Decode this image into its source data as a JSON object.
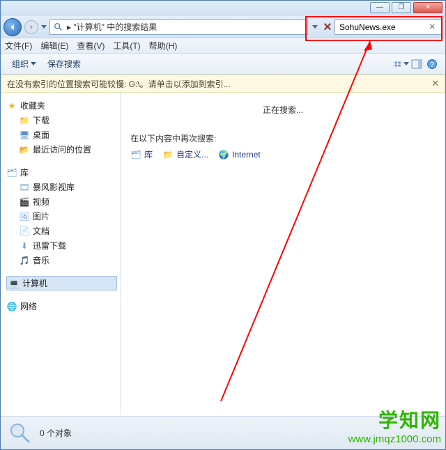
{
  "titlebar": {
    "min": "—",
    "max": "❐",
    "close": "✕"
  },
  "address": {
    "text": "\"计算机\" 中的搜索结果"
  },
  "search": {
    "value": "SohuNews.exe"
  },
  "menubar": [
    "文件(F)",
    "编辑(E)",
    "查看(V)",
    "工具(T)",
    "帮助(H)"
  ],
  "toolbar": {
    "organize": "组织",
    "save_search": "保存搜索"
  },
  "warning": {
    "text": "在没有索引的位置搜索可能较慢: G:\\。请单击以添加到索引..."
  },
  "tree": {
    "favorites": {
      "label": "收藏夹",
      "items": [
        "下载",
        "桌面",
        "最近访问的位置"
      ]
    },
    "library": {
      "label": "库",
      "items": [
        "暴风影视库",
        "视频",
        "图片",
        "文档",
        "迅雷下载",
        "音乐"
      ]
    },
    "computer": {
      "label": "计算机"
    },
    "network": {
      "label": "网络"
    }
  },
  "content": {
    "searching": "正在搜索...",
    "again_label": "在以下内容中再次搜索:",
    "again_items": [
      "库",
      "自定义...",
      "Internet"
    ]
  },
  "status": {
    "count": "0 个对象"
  },
  "watermark": {
    "line1": "学知网",
    "line2": "www.jmqz1000.com"
  }
}
